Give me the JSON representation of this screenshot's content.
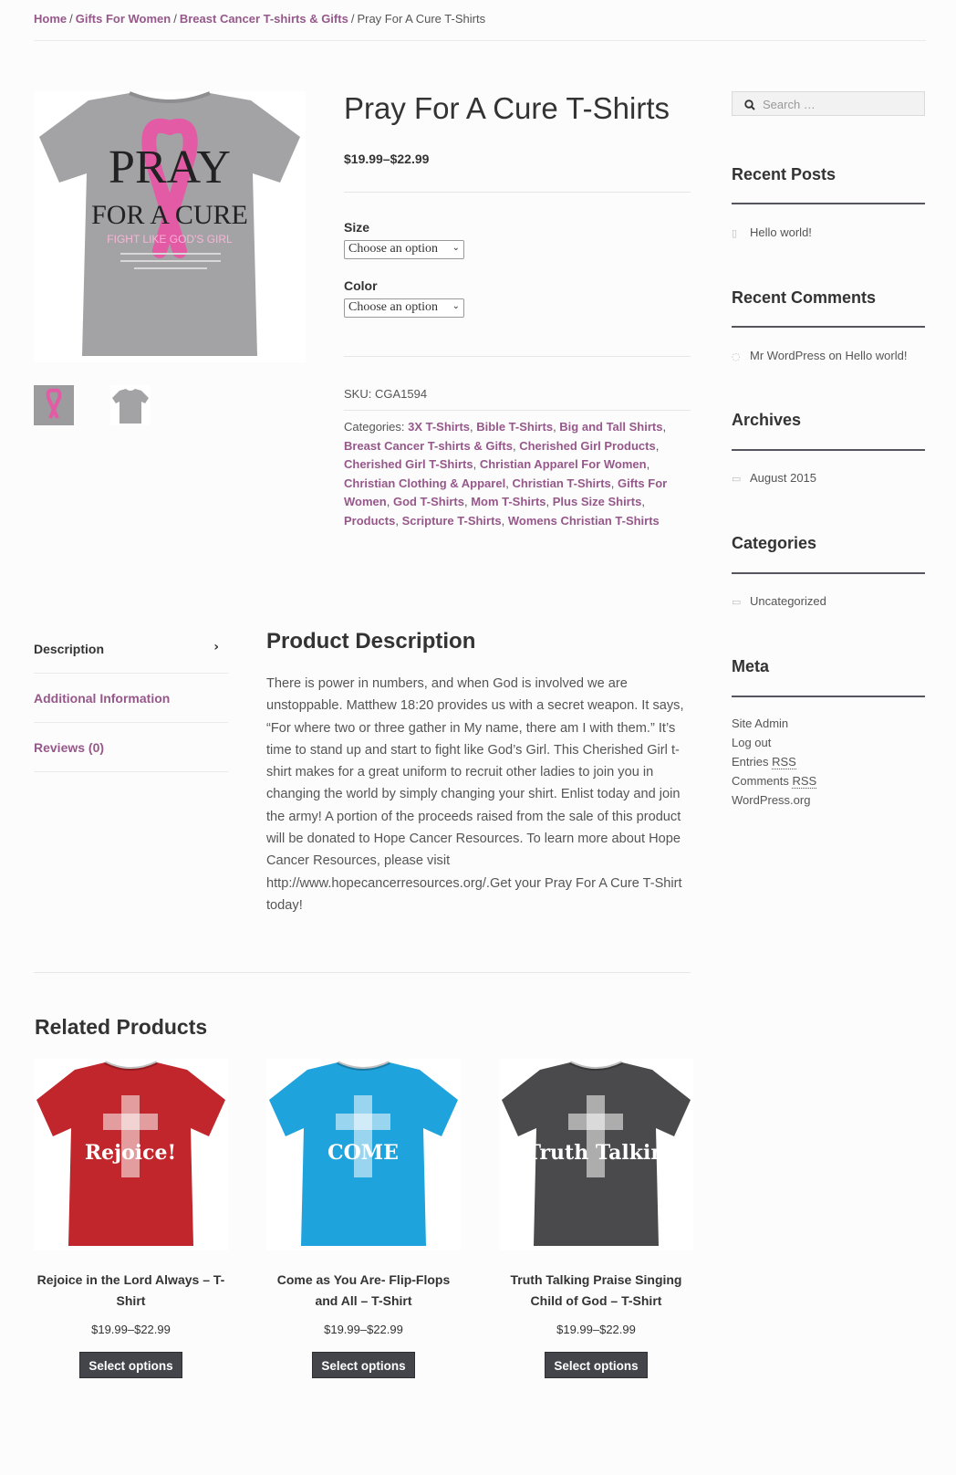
{
  "breadcrumb": {
    "home": "Home",
    "gifts_for_women": "Gifts For Women",
    "breast_cancer": "Breast Cancer T-shirts & Gifts",
    "current": "Pray For A Cure T-Shirts",
    "separator": "/"
  },
  "product": {
    "title": "Pray For A Cure T-Shirts",
    "price": "$19.99–$22.99",
    "size_label": "Size",
    "size_value": "Choose an option",
    "color_label": "Color",
    "color_value": "Choose an option",
    "sku_label": "SKU:",
    "sku_value": "CGA1594",
    "categories_label": "Categories:",
    "categories": [
      "3X T-Shirts",
      "Bible T-Shirts",
      "Big and Tall Shirts",
      "Breast Cancer T-shirts & Gifts",
      "Cherished Girl Products",
      "Cherished Girl T-Shirts",
      "Christian Apparel For Women",
      "Christian Clothing & Apparel",
      "Christian T-Shirts",
      "Gifts For Women",
      "God T-Shirts",
      "Mom T-Shirts",
      "Plus Size Shirts",
      "Products",
      "Scripture T-Shirts",
      "Womens Christian T-Shirts"
    ],
    "shirt_print": {
      "line1": "PRAY",
      "line2": "FOR A CURE",
      "line3": "FIGHT LIKE GOD'S GIRL"
    }
  },
  "tabs": {
    "description": "Description",
    "additional": "Additional Information",
    "reviews": "Reviews (0)",
    "arrow": "›"
  },
  "description": {
    "title": "Product Description",
    "text": "There is power in numbers, and when God is involved we are unstoppable. Matthew 18:20 provides us with a secret weapon. It says, “For where two or three gather in My name, there am I with them.” It’s time to stand up and start to fight like God’s Girl. This Cherished Girl t-shirt makes for a great uniform to recruit other ladies to join you in changing the world by simply changing your shirt. Enlist today and join the army! A portion of the proceeds raised from the sale of this product will be donated to Hope Cancer Resources. To learn more about Hope Cancer Resources, please visit http://www.hopecancerresources.org/.Get your Pray For A Cure T-Shirt today!"
  },
  "related": {
    "title": "Related Products",
    "products": [
      {
        "name": "Rejoice in the Lord Always – T-Shirt",
        "price": "$19.99–$22.99",
        "button": "Select options",
        "color": "#c0262b",
        "print": "Rejoice!"
      },
      {
        "name": "Come as You Are- Flip-Flops and All – T-Shirt",
        "price": "$19.99–$22.99",
        "button": "Select options",
        "color": "#1ea3dc",
        "print": "COME"
      },
      {
        "name": "Truth Talking Praise Singing Child of God – T-Shirt",
        "price": "$19.99–$22.99",
        "button": "Select options",
        "color": "#4a4a4c",
        "print": "Truth Talkin"
      }
    ]
  },
  "sidebar": {
    "search_placeholder": "Search …",
    "recent_posts_title": "Recent Posts",
    "recent_post": "Hello world!",
    "recent_comments_title": "Recent Comments",
    "comment_author": "Mr WordPress",
    "comment_on": "on",
    "comment_post": "Hello world!",
    "archives_title": "Archives",
    "archive_item": "August 2015",
    "categories_title": "Categories",
    "category_item": "Uncategorized",
    "meta_title": "Meta",
    "meta_site_admin": "Site Admin",
    "meta_log_out": "Log out",
    "meta_entries": "Entries",
    "meta_comments": "Comments",
    "meta_rss": "RSS",
    "meta_wordpress": "WordPress.org"
  },
  "colors": {
    "accent": "#96588a",
    "button": "#43454b",
    "shirt_gray": "#9c9c9e"
  }
}
